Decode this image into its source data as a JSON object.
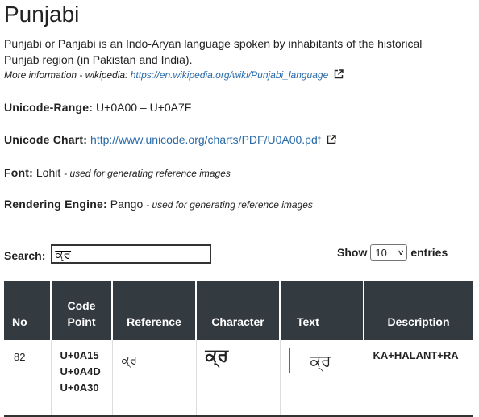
{
  "title": "Punjabi",
  "description": "Punjabi or Panjabi is an Indo-Aryan language spoken by inhabitants of the historical Punjab region (in Pakistan and India).",
  "more_info": {
    "label": "More information - wikipedia:",
    "link": "https://en.wikipedia.org/wiki/Punjabi_language"
  },
  "unicode_range": {
    "key": "Unicode-Range:",
    "value": "U+0A00 – U+0A7F"
  },
  "unicode_chart": {
    "key": "Unicode Chart:",
    "link": "http://www.unicode.org/charts/PDF/U0A00.pdf"
  },
  "font": {
    "key": "Font:",
    "value": "Lohit",
    "note": "- used for generating reference images"
  },
  "rendering_engine": {
    "key": "Rendering Engine:",
    "value": "Pango",
    "note": "- used for generating reference images"
  },
  "search": {
    "label": "Search:",
    "value": "ਕ੍ਰ"
  },
  "show_entries": {
    "show_label": "Show",
    "selected": "10",
    "entries_label": "entries"
  },
  "table": {
    "headers": [
      "No",
      "Code Point",
      "Reference",
      "Character",
      "Text",
      "Description"
    ],
    "rows": [
      {
        "no": "82",
        "code_points": [
          "U+0A15",
          "U+0A4D",
          "U+0A30"
        ],
        "reference": "ਕ੍ਰ",
        "character": "ਕ੍ਰ",
        "text": "ਕ੍ਰ",
        "description": "KA+HALANT+RA"
      }
    ]
  },
  "colors": {
    "link": "#2a6aa8",
    "table_header_bg": "#333a40",
    "text": "#222222"
  }
}
